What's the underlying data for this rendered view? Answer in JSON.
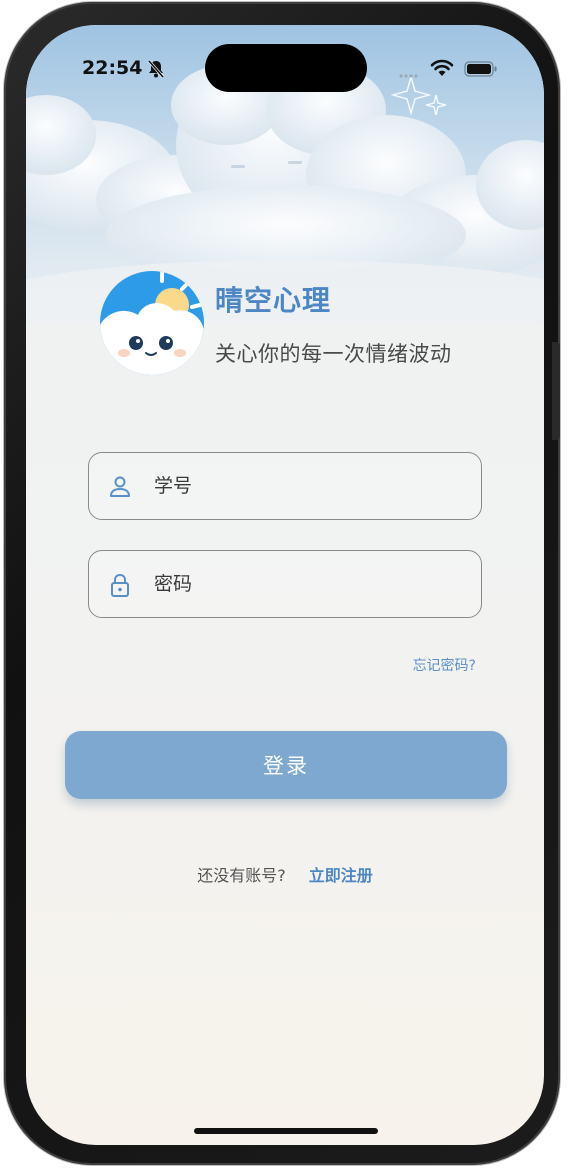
{
  "status_bar": {
    "time": "22:54",
    "icons": [
      "bell-slash-icon",
      "signal-icon",
      "wifi-icon",
      "battery-icon"
    ]
  },
  "app": {
    "title": "晴空心理",
    "slogan": "关心你的每一次情绪波动",
    "logo_icon": "cloud-sun-mascot-icon"
  },
  "form": {
    "student_id": {
      "placeholder": "学号",
      "value": "",
      "icon": "user-icon"
    },
    "password": {
      "placeholder": "密码",
      "value": "",
      "icon": "lock-icon"
    },
    "forgot_password": "忘记密码?",
    "login_button": "登录"
  },
  "register": {
    "prompt": "还没有账号?",
    "link": "立即注册"
  },
  "colors": {
    "accent": "#4d86c4",
    "button": "#7ea8d0",
    "background_top": "#eef1f3",
    "background_bottom": "#f7f3ec"
  }
}
